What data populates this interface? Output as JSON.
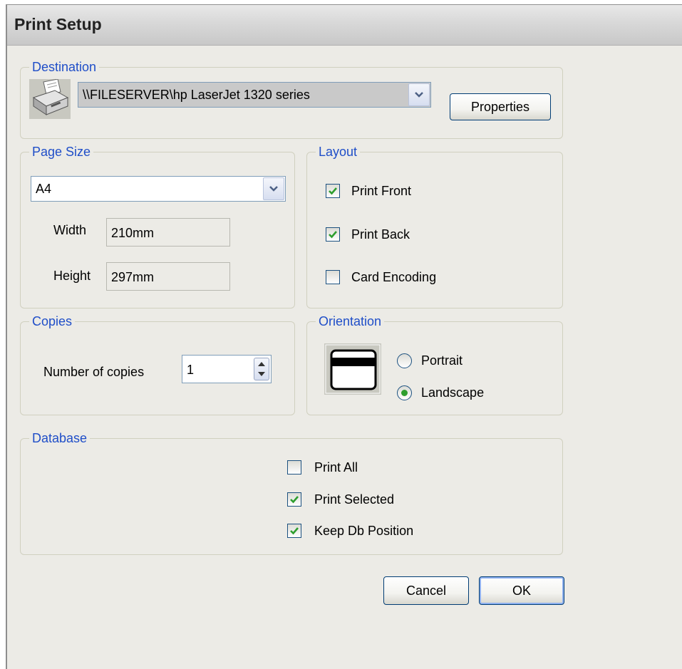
{
  "window": {
    "title": "Print Setup"
  },
  "destination": {
    "label": "Destination",
    "printer": "\\\\FILESERVER\\hp LaserJet 1320 series",
    "printer_icon": "printer-icon",
    "properties_button": "Properties"
  },
  "page_size": {
    "label": "Page Size",
    "selected": "A4",
    "width_label": "Width",
    "width_value": "210mm",
    "height_label": "Height",
    "height_value": "297mm"
  },
  "layout": {
    "label": "Layout",
    "options": [
      {
        "label": "Print Front",
        "checked": true
      },
      {
        "label": "Print Back",
        "checked": true
      },
      {
        "label": "Card Encoding",
        "checked": false
      }
    ]
  },
  "copies": {
    "label": "Copies",
    "number_label": "Number of copies",
    "value": "1"
  },
  "orientation": {
    "label": "Orientation",
    "preview_icon": "card-landscape-icon",
    "options": [
      {
        "label": "Portrait",
        "selected": false
      },
      {
        "label": "Landscape",
        "selected": true
      }
    ]
  },
  "database": {
    "label": "Database",
    "options": [
      {
        "label": "Print All",
        "checked": false
      },
      {
        "label": "Print Selected",
        "checked": true
      },
      {
        "label": "Keep Db Position",
        "checked": true
      }
    ]
  },
  "buttons": {
    "cancel": "Cancel",
    "ok": "OK"
  },
  "colors": {
    "group_label": "#1f4ec8",
    "check": "#2e9e2e",
    "dialog_bg": "#ecebe6"
  }
}
